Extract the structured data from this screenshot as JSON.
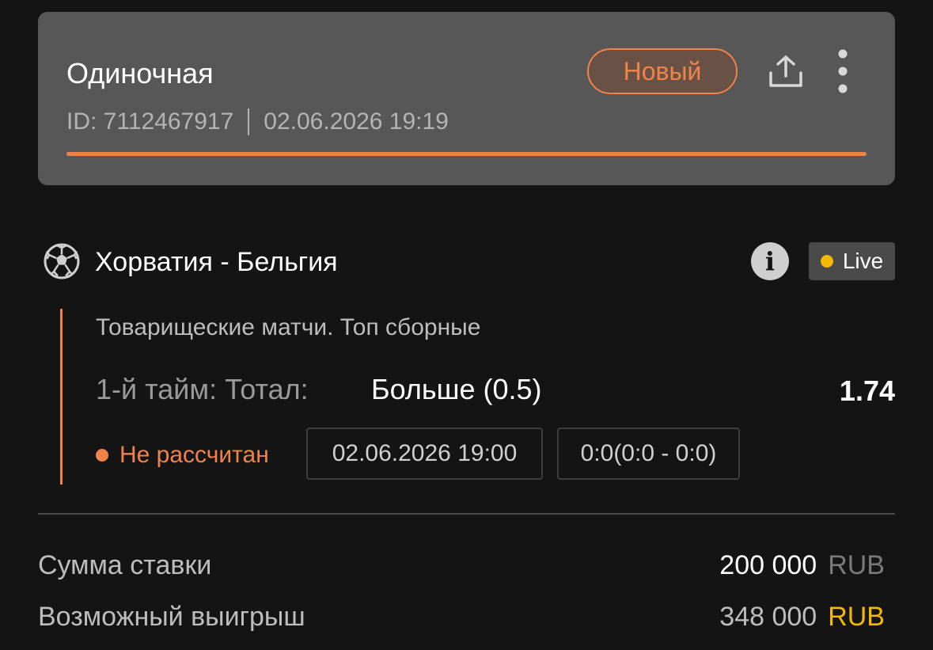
{
  "header": {
    "bet_type": "Одиночная",
    "status_badge": "Новый",
    "bet_id": "ID: 7112467917",
    "created_at": "02.06.2026 19:19",
    "progress": 1.0,
    "icons": {
      "share": "share-icon",
      "more": "more-vertical-icon"
    },
    "accent_color": "#f0834a"
  },
  "event": {
    "sport_icon": "soccer-ball-icon",
    "title": "Хорватия - Бельгия",
    "info_icon": "info-icon",
    "live_label": "Live",
    "live_color": "#f5b800"
  },
  "selection": {
    "tournament": "Товарищеские матчи. Топ сборные",
    "market": "1-й тайм: Тотал:",
    "outcome": "Больше (0.5)",
    "coefficient": "1.74",
    "status": "Не рассчитан",
    "start_time": "02.06.2026 19:00",
    "score": "0:0(0:0 - 0:0)"
  },
  "summary": {
    "stake_label": "Сумма ставки",
    "stake_amount": "200 000",
    "stake_currency": "RUB",
    "payout_label": "Возможный выигрыш",
    "payout_amount": "348 000",
    "payout_currency": "RUB",
    "payout_currency_color": "#f5b800"
  }
}
